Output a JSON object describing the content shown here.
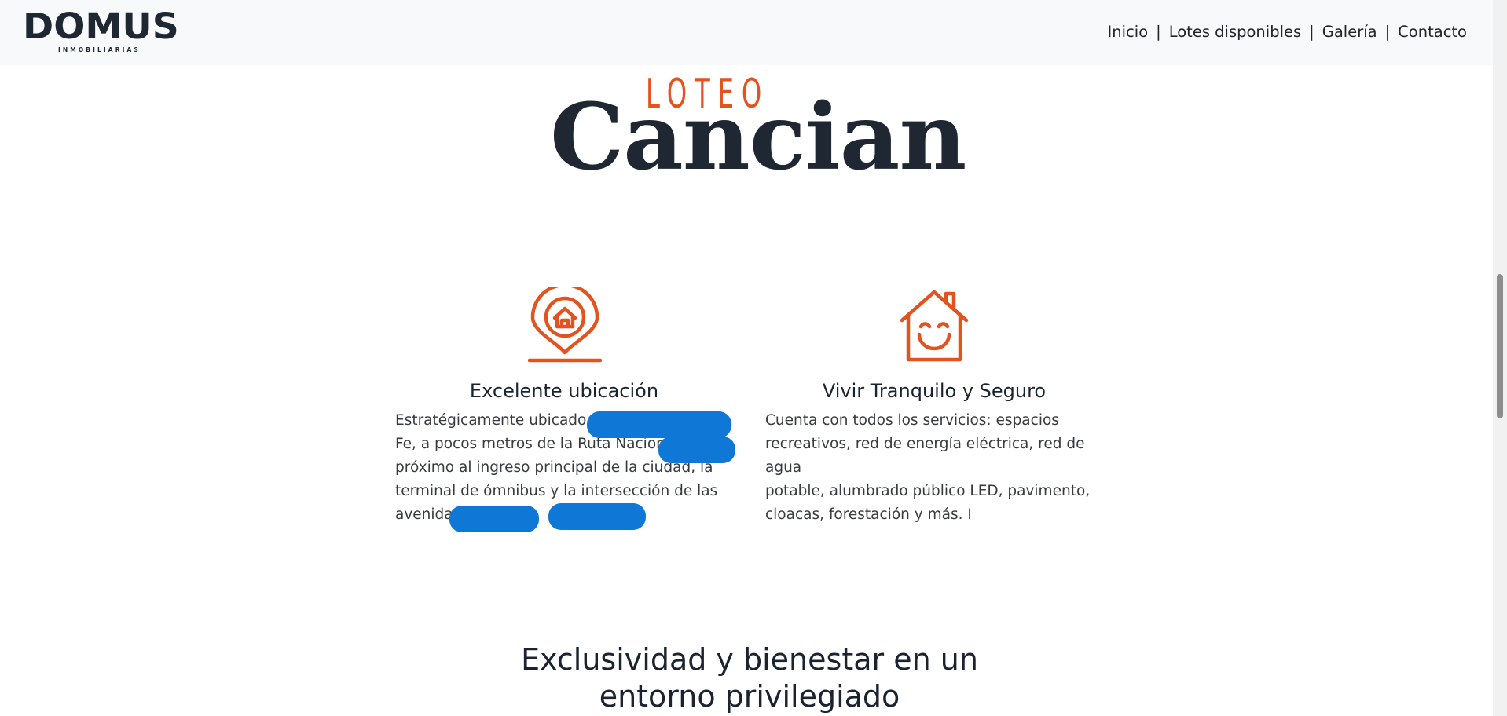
{
  "brand": {
    "name": "DOMUS",
    "tagline": "INMOBILIARIAS"
  },
  "nav": {
    "links": [
      "Inicio",
      "Lotes disponibles",
      "Galería",
      "Contacto"
    ],
    "separator": "|"
  },
  "hero": {
    "overline": "LOTEO",
    "title": "Cancian"
  },
  "features": [
    {
      "icon": "location-house-pin-icon",
      "title": "Excelente ubicación",
      "lines": [
        "Estratégicamente ubicado e",
        "Fe, a pocos metros de la Ruta Naciona",
        "próximo al ingreso principal de la ciudad, la",
        "terminal de ómnibus y la intersección de las",
        "avenida",
        "y"
      ]
    },
    {
      "icon": "smiling-house-icon",
      "title": "Vivir Tranquilo y Seguro",
      "lines": [
        "Cuenta con todos los servicios: espacios",
        "recreativos, red de energía eléctrica, red de agua",
        "potable, alumbrado público LED, pavimento,",
        "cloacas, forestación y más. I"
      ]
    }
  ],
  "section": {
    "title_line1": "Exclusividad y bienestar en un",
    "title_line2": "entorno privilegiado"
  },
  "colors": {
    "accent": "#e2531f",
    "dark": "#1e2732",
    "navbar_bg": "#f8f9fa",
    "redaction": "#0f78d7"
  }
}
